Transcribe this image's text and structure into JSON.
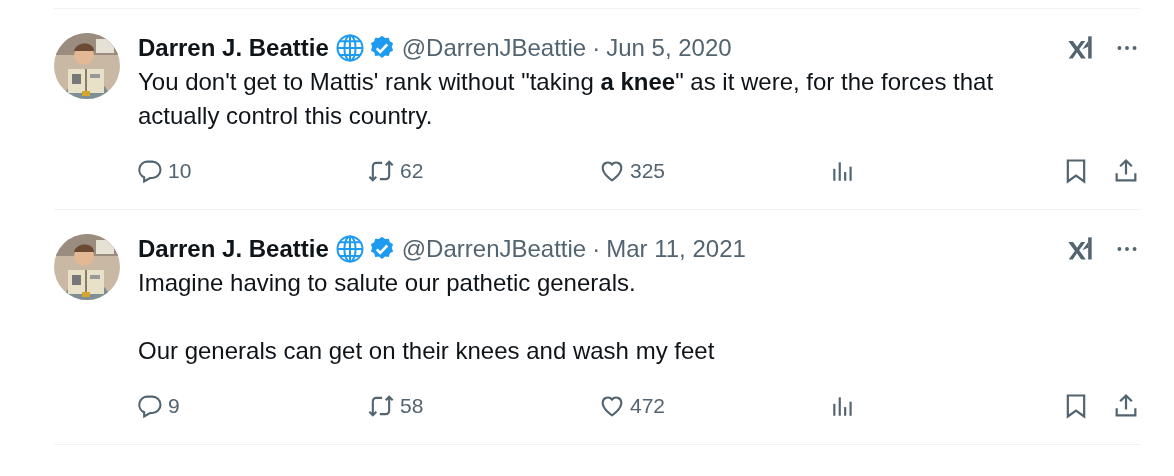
{
  "tweets": [
    {
      "name": "Darren J. Beattie",
      "handle": "@DarrenJBeattie",
      "separator": "·",
      "date": "Jun 5, 2020",
      "verified": true,
      "text": "You don't get to Mattis' rank without \"taking **a knee**\" as it were, for the forces that actually control this country.",
      "replies": "10",
      "reposts": "62",
      "likes": "325"
    },
    {
      "name": "Darren J. Beattie",
      "handle": "@DarrenJBeattie",
      "separator": "·",
      "date": "Mar 11, 2021",
      "verified": true,
      "text": "Imagine having to salute our pathetic generals.\n\nOur generals can get on their knees and wash my feet",
      "replies": "9",
      "reposts": "58",
      "likes": "472"
    }
  ]
}
